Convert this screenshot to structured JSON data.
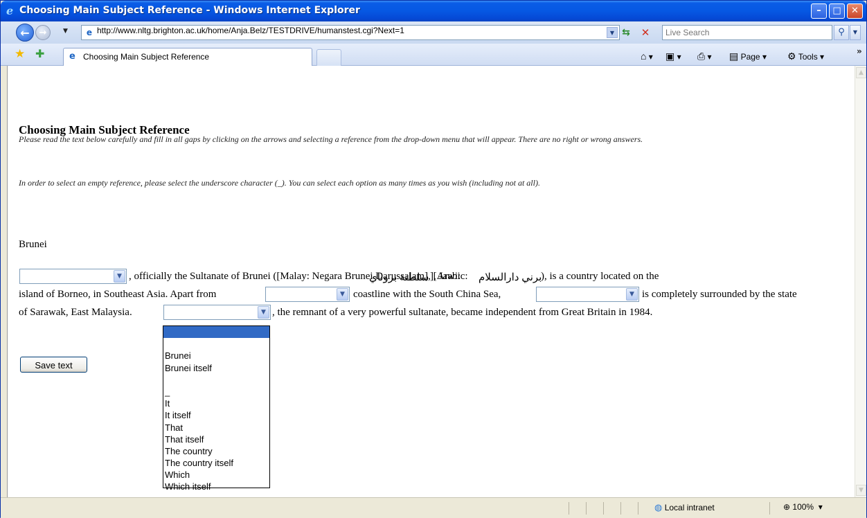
{
  "window": {
    "title": "Choosing Main Subject Reference - Windows Internet Explorer",
    "minimize": "–",
    "maximize": "□",
    "close": "✕"
  },
  "toolbar": {
    "back": "←",
    "forward": "→",
    "url": "http://www.nltg.brighton.ac.uk/home/Anja.Belz/TESTDRIVE/humanstest.cgi?Next=1",
    "search_placeholder": "Live Search"
  },
  "tabs": [
    {
      "label": "Choosing Main Subject Reference"
    }
  ],
  "command_bar": {
    "page": "Page",
    "tools": "Tools"
  },
  "page": {
    "title": "Choosing Main Subject Reference",
    "instruction_1": "Please read the text below carefully and fill in all gaps by clicking on the arrows and selecting a reference from the drop-down menu that will appear. There are no right or wrong answers.",
    "instruction_2": "In order to select an empty reference, please select the underscore character (_). You can select each option as many times as you wish (including not at all).",
    "heading": "Brunei",
    "line1_part1": ", officially the Sultanate of Brunei ([Malay: Negara Brunei Darussalam], [Arabic: ",
    "arabic_1": "سلطنة بروناي",
    "line1_part2": "], Jawi: ",
    "arabic_2": "برني دارالسلام",
    "line1_part3": "), is a country located on the",
    "line2_part1": "island of Borneo, in Southeast Asia. Apart from",
    "line2_part2": "coastline with the South China Sea,",
    "line2_part3": "is completely surrounded by the state",
    "line3_part1": "of Sarawak, East Malaysia.",
    "line3_part2": ", the remnant of a very powerful sultanate, became independent from Great Britain in 1984.",
    "save_button": "Save text"
  },
  "dropdown": {
    "options": [
      "",
      "",
      "Brunei",
      "Brunei itself",
      "",
      "_",
      "It",
      "It itself",
      "That",
      "That itself",
      "The country",
      "The country itself",
      "Which",
      "Which itself"
    ],
    "selected_index": 0
  },
  "statusbar": {
    "zone": "Local intranet",
    "zoom": "100%"
  }
}
